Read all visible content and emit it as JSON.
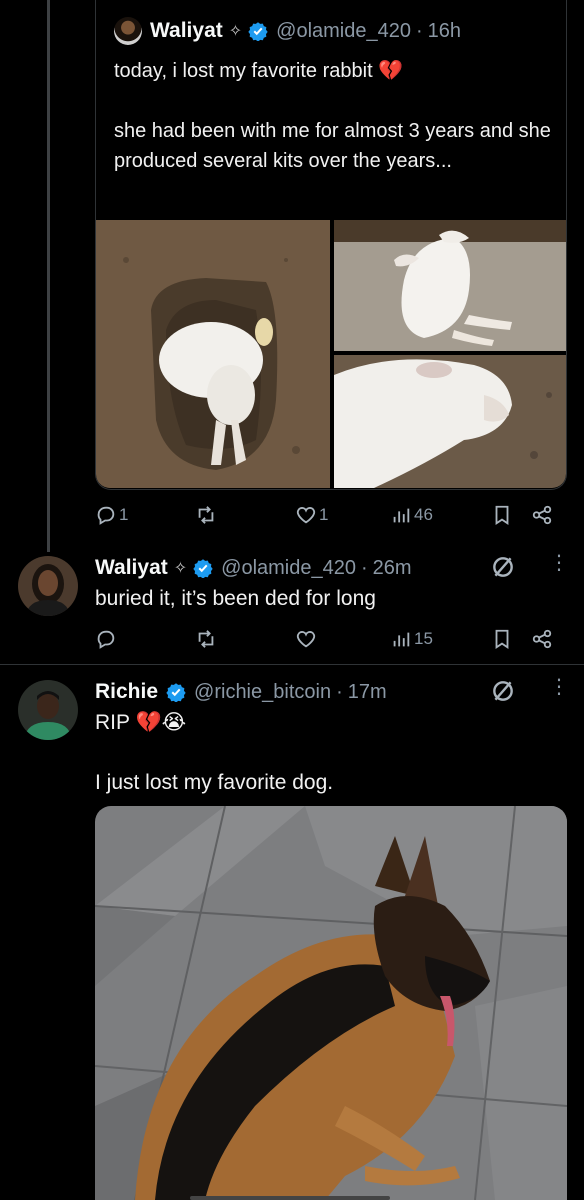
{
  "quoted_tweet": {
    "name": "Waliyat",
    "sparkle": "✧",
    "handle": "@olamide_420",
    "time": "16h",
    "line1": "today, i lost my favorite rabbit 💔",
    "line2": "she had been with me for almost 3 years and she produced several kits over the years..."
  },
  "quoted_actions": {
    "replies": "1",
    "reposts": "",
    "likes": "1",
    "views": "46"
  },
  "reply1": {
    "name": "Waliyat",
    "sparkle": "✧",
    "handle": "@olamide_420",
    "time": "26m",
    "text": "buried it, it’s been ded for long",
    "replies": "",
    "reposts": "",
    "likes": "",
    "views": "15"
  },
  "reply2": {
    "name": "Richie",
    "handle": "@richie_bitcoin",
    "time": "17m",
    "line1": "RIP 💔😭",
    "line2": "I just lost my favorite dog."
  },
  "icons": {
    "reply": "reply-icon",
    "repost": "repost-icon",
    "like": "heart-icon",
    "views": "views-icon",
    "bookmark": "bookmark-icon",
    "share": "share-icon",
    "grok": "grok-icon",
    "more": "more-icon",
    "verified": "verified-badge-icon"
  },
  "colors": {
    "background": "#000000",
    "verified": "#1d9bf0",
    "muted": "#8b98a5"
  }
}
